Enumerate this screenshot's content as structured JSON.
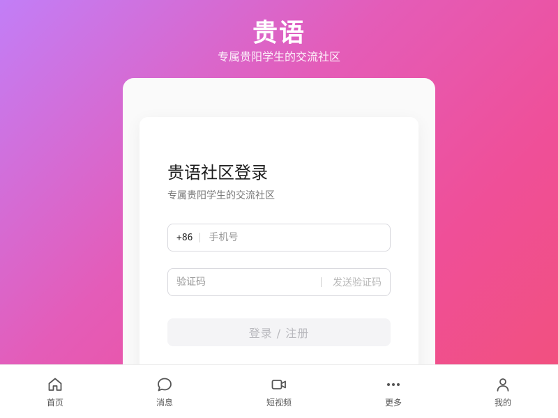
{
  "header": {
    "title": "贵语",
    "subtitle": "专属贵阳学生的交流社区"
  },
  "login": {
    "title": "贵语社区登录",
    "subtitle": "专属贵阳学生的交流社区",
    "phone_prefix": "+86",
    "phone_placeholder": "手机号",
    "code_placeholder": "验证码",
    "send_code_label": "发送验证码",
    "submit_label": "登录 / 注册"
  },
  "bottom_nav": {
    "items": [
      {
        "label": "首页",
        "icon": "home-icon"
      },
      {
        "label": "消息",
        "icon": "message-icon"
      },
      {
        "label": "短视频",
        "icon": "video-icon"
      },
      {
        "label": "更多",
        "icon": "more-icon"
      },
      {
        "label": "我的",
        "icon": "user-icon"
      }
    ]
  },
  "colors": {
    "gradient_start": "#c27ef7",
    "gradient_mid": "#e45cb8",
    "gradient_end": "#f2507a",
    "button_bg": "#f4f4f6",
    "button_text": "#b9b9be"
  }
}
